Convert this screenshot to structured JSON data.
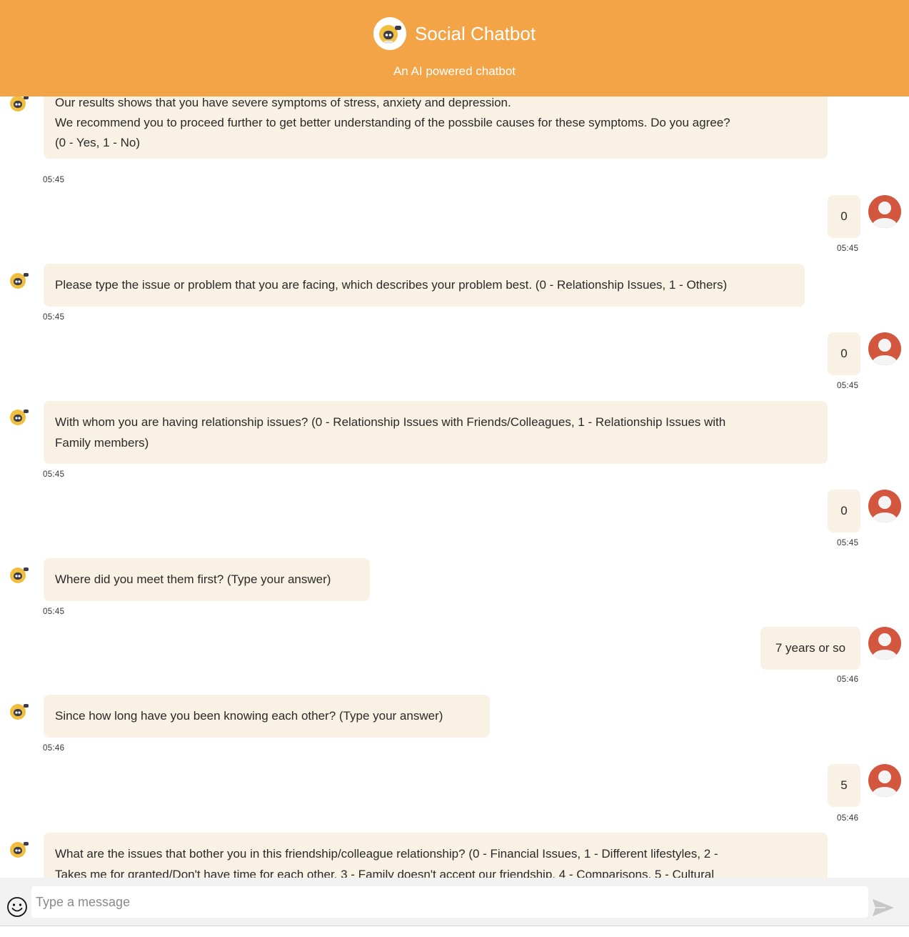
{
  "header": {
    "title": "Social Chatbot",
    "subtitle": "An AI powered chatbot",
    "logo_icon": "robot-icon"
  },
  "colors": {
    "header_bg": "#f2a447",
    "bubble_bg": "#f8f1e4",
    "user_avatar": "#d3573f",
    "bot_avatar": "#f0bf3f"
  },
  "messages": [
    {
      "sender": "bot",
      "lines": [
        "Our results shows that you have severe symptoms of stress, anxiety and depression.",
        "We recommend you to proceed further to get better understanding of the possbile causes for these symptoms. Do you agree?",
        "(0 - Yes, 1 - No)"
      ],
      "time": "05:45"
    },
    {
      "sender": "user",
      "text": "0",
      "time": "05:45"
    },
    {
      "sender": "bot",
      "lines": [
        "Please type the issue or problem that you are facing, which describes your problem best. (0 - Relationship Issues, 1 - Others)"
      ],
      "time": "05:45"
    },
    {
      "sender": "user",
      "text": "0",
      "time": "05:45"
    },
    {
      "sender": "bot",
      "lines": [
        "With whom you are having relationship issues? (0 - Relationship Issues with Friends/Colleagues, 1 - Relationship Issues with",
        "Family members)"
      ],
      "time": "05:45"
    },
    {
      "sender": "user",
      "text": "0",
      "time": "05:45"
    },
    {
      "sender": "bot",
      "lines": [
        "Where did you meet them first? (Type your answer)"
      ],
      "time": "05:45"
    },
    {
      "sender": "user",
      "text": "7 years or so",
      "time": "05:46"
    },
    {
      "sender": "bot",
      "lines": [
        "Since how long have you been knowing each other? (Type your answer)"
      ],
      "time": "05:46"
    },
    {
      "sender": "user",
      "text": "5",
      "time": "05:46"
    },
    {
      "sender": "bot",
      "lines": [
        "What are the issues that bother you in this friendship/colleague relationship? (0 - Financial Issues, 1 - Different lifestyles, 2 -",
        "Takes me for granted/Don't have time for each other, 3 - Family doesn't accept our friendship, 4 - Comparisons, 5 - Cultural"
      ],
      "time": ""
    }
  ],
  "composer": {
    "placeholder": "Type a message",
    "value": "",
    "emoji_icon": "smiley-icon",
    "send_icon": "send-icon"
  }
}
